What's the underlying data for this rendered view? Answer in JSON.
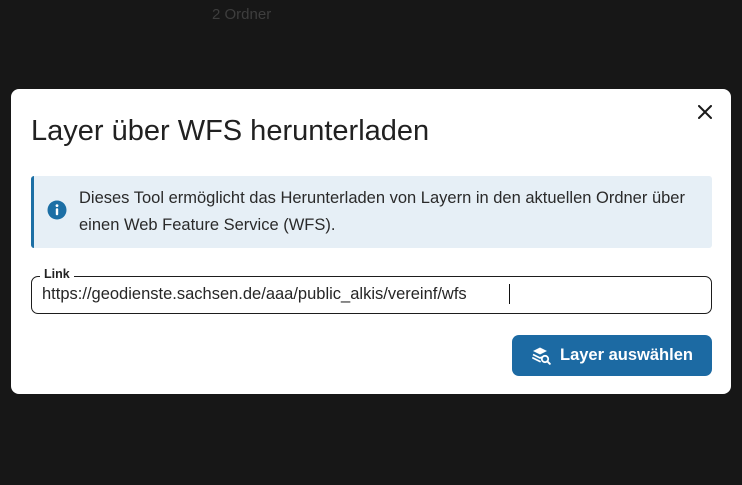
{
  "background": {
    "folder_label": "2 Ordner"
  },
  "dialog": {
    "title": "Layer über WFS herunterladen",
    "close_icon": "close-icon",
    "info": {
      "icon": "info-icon",
      "text": "Dieses Tool ermöglicht das Herunterladen von Layern in den aktuellen Ordner über einen Web Feature Service (WFS)."
    },
    "link_field": {
      "label": "Link",
      "value": "https://geodienste.sachsen.de/aaa/public_alkis/vereinf/wfs"
    },
    "action_button": {
      "icon": "layer-search-icon",
      "label": "Layer auswählen"
    }
  },
  "colors": {
    "accent": "#1c6aa3",
    "info_background": "#e6eff6",
    "backdrop": "#171717"
  }
}
